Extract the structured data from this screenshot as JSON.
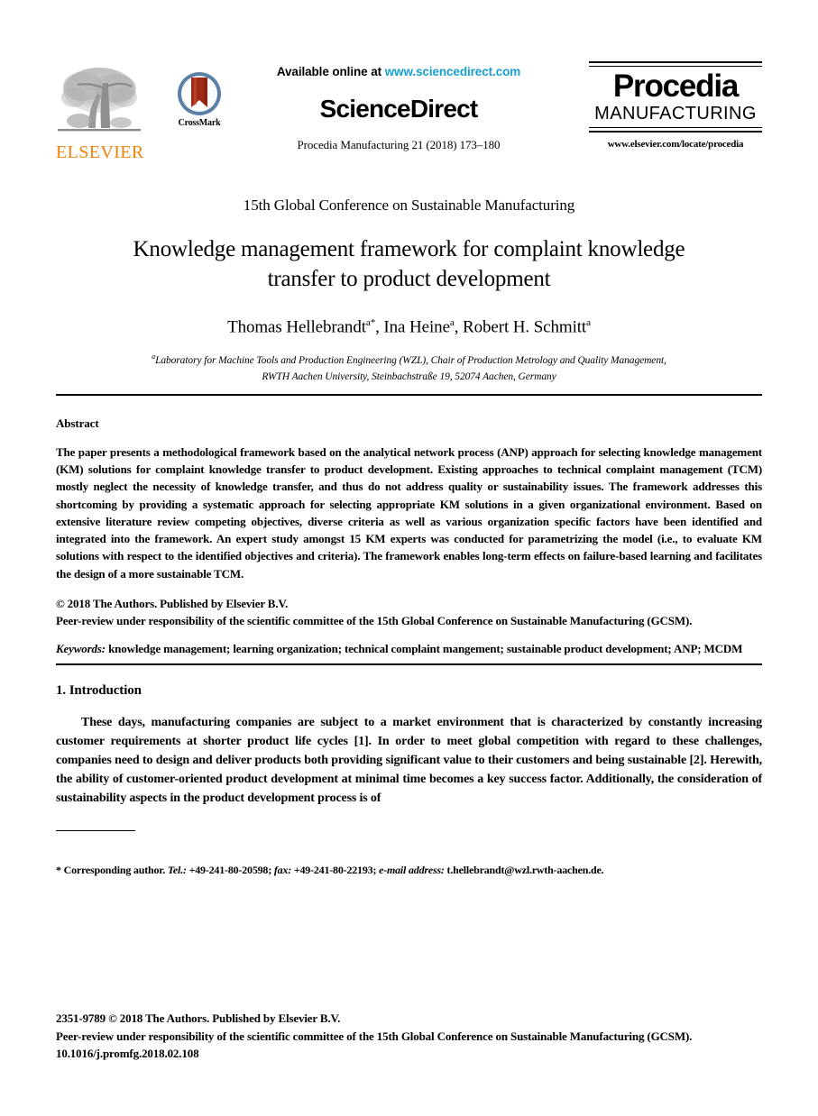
{
  "masthead": {
    "elsevier": {
      "wordmark": "ELSEVIER",
      "tree_icon": "elsevier-tree-icon"
    },
    "crossmark": {
      "label": "CrossMark",
      "icon": "crossmark-badge-icon"
    },
    "sciencedirect": {
      "available_prefix": "Available online at ",
      "url": "www.sciencedirect.com",
      "wordmark": "ScienceDirect",
      "journal_line": "Procedia Manufacturing 21 (2018) 173–180"
    },
    "procedia": {
      "title": "Procedia",
      "subtitle": "MANUFACTURING",
      "url": "www.elsevier.com/locate/procedia"
    }
  },
  "title_block": {
    "conference": "15th Global Conference on Sustainable Manufacturing",
    "title_line1": "Knowledge management framework for complaint knowledge",
    "title_line2": "transfer to product development",
    "authors_plain": "Thomas Hellebrandt",
    "authors": [
      {
        "name": "Thomas Hellebrandt",
        "marks": "a*"
      },
      {
        "name": "Ina Heine",
        "marks": "a"
      },
      {
        "name": "Robert H. Schmitt",
        "marks": "a"
      }
    ],
    "affiliation_mark": "a",
    "affiliation_line1": "Laboratory for Machine Tools and Production Engineering (WZL), Chair of Production Metrology and Quality Management,",
    "affiliation_line2": "RWTH Aachen University, Steinbachstraße 19, 52074 Aachen, Germany"
  },
  "abstract": {
    "heading": "Abstract",
    "body": "The paper presents a methodological framework based on the analytical network process (ANP) approach for selecting knowledge management (KM) solutions for complaint knowledge transfer to product development. Existing approaches to technical complaint management (TCM) mostly neglect the necessity of knowledge transfer, and thus do not address quality or sustainability issues. The framework addresses this shortcoming by providing a systematic approach for selecting appropriate KM solutions in a given organizational environment. Based on extensive literature review competing objectives, diverse criteria as well as various organization specific factors have been identified and integrated into the framework. An expert study amongst 15 KM experts was conducted for parametrizing the model (i.e., to evaluate KM solutions with respect to the identified objectives and criteria). The framework enables long-term effects on failure-based learning and facilitates the design of a more sustainable TCM.",
    "copyright": "© 2018 The Authors. Published by Elsevier B.V.",
    "peer_review": "Peer-review under responsibility of the scientific committee of the 15th Global Conference on Sustainable Manufacturing (GCSM).",
    "keywords_label": "Keywords:",
    "keywords_text": " knowledge management; learning organization; technical complaint mangement; sustainable product development; ANP; MCDM"
  },
  "introduction": {
    "heading": "1. Introduction",
    "paragraph": "These days, manufacturing companies are subject to a market environment that is characterized by constantly increasing customer requirements at shorter product life cycles [1]. In order to meet global competition with regard to these challenges, companies need to design and deliver products both providing significant value to their customers and being sustainable [2]. Herewith, the ability of customer-oriented product development at minimal time becomes a key success factor. Additionally, the consideration of sustainability aspects in the product development process is of"
  },
  "footnote": {
    "marker": "* Corresponding author. ",
    "tel_label": "Tel.:",
    "tel_value": " +49-241-80-20598; ",
    "fax_label": "fax:",
    "fax_value": " +49-241-80-22193; ",
    "email_label": "e-mail address:",
    "email_value": " t.hellebrandt@wzl.rwth-aachen.de."
  },
  "page_footer": {
    "line1": "2351-9789 © 2018 The Authors. Published by Elsevier B.V.",
    "line2": "Peer-review under responsibility of the scientific committee of the 15th Global Conference on Sustainable Manufacturing (GCSM).",
    "line3": "10.1016/j.promfg.2018.02.108"
  },
  "colors": {
    "elsevier_orange": "#f1820a",
    "sciencedirect_blue": "#16a0d2",
    "crossmark_ring": "#5b7fa6",
    "crossmark_ribbon": "#9e2b16"
  }
}
